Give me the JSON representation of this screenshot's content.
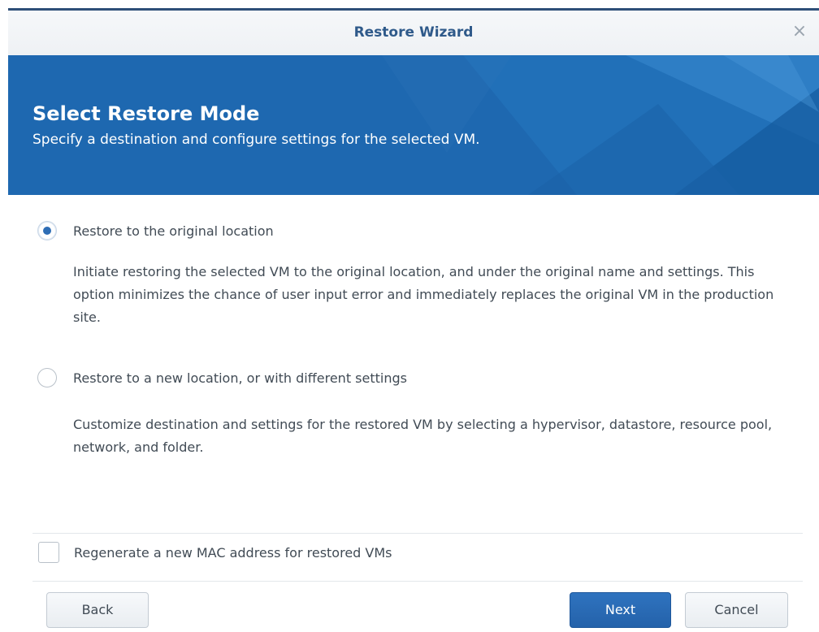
{
  "window": {
    "title": "Restore Wizard",
    "close_icon": "close-icon"
  },
  "banner": {
    "title": "Select Restore Mode",
    "subtitle": "Specify a destination and configure settings for the selected VM."
  },
  "options": [
    {
      "label": "Restore to the original location",
      "description": "Initiate restoring the selected VM to the original location, and under the original name and settings. This option minimizes the chance of user input error and immediately replaces the original VM in the production site.",
      "selected": true
    },
    {
      "label": "Restore to a new location, or with different settings",
      "description": "Customize destination and settings for the restored VM by selecting a hypervisor, datastore, resource pool, network, and folder.",
      "selected": false
    }
  ],
  "mac_option": {
    "label": "Regenerate a new MAC address for restored VMs",
    "checked": false
  },
  "buttons": {
    "back": "Back",
    "next": "Next",
    "cancel": "Cancel"
  },
  "colors": {
    "accent": "#2e6db5",
    "banner": "#1f6bb4",
    "title": "#2f5a8a"
  }
}
